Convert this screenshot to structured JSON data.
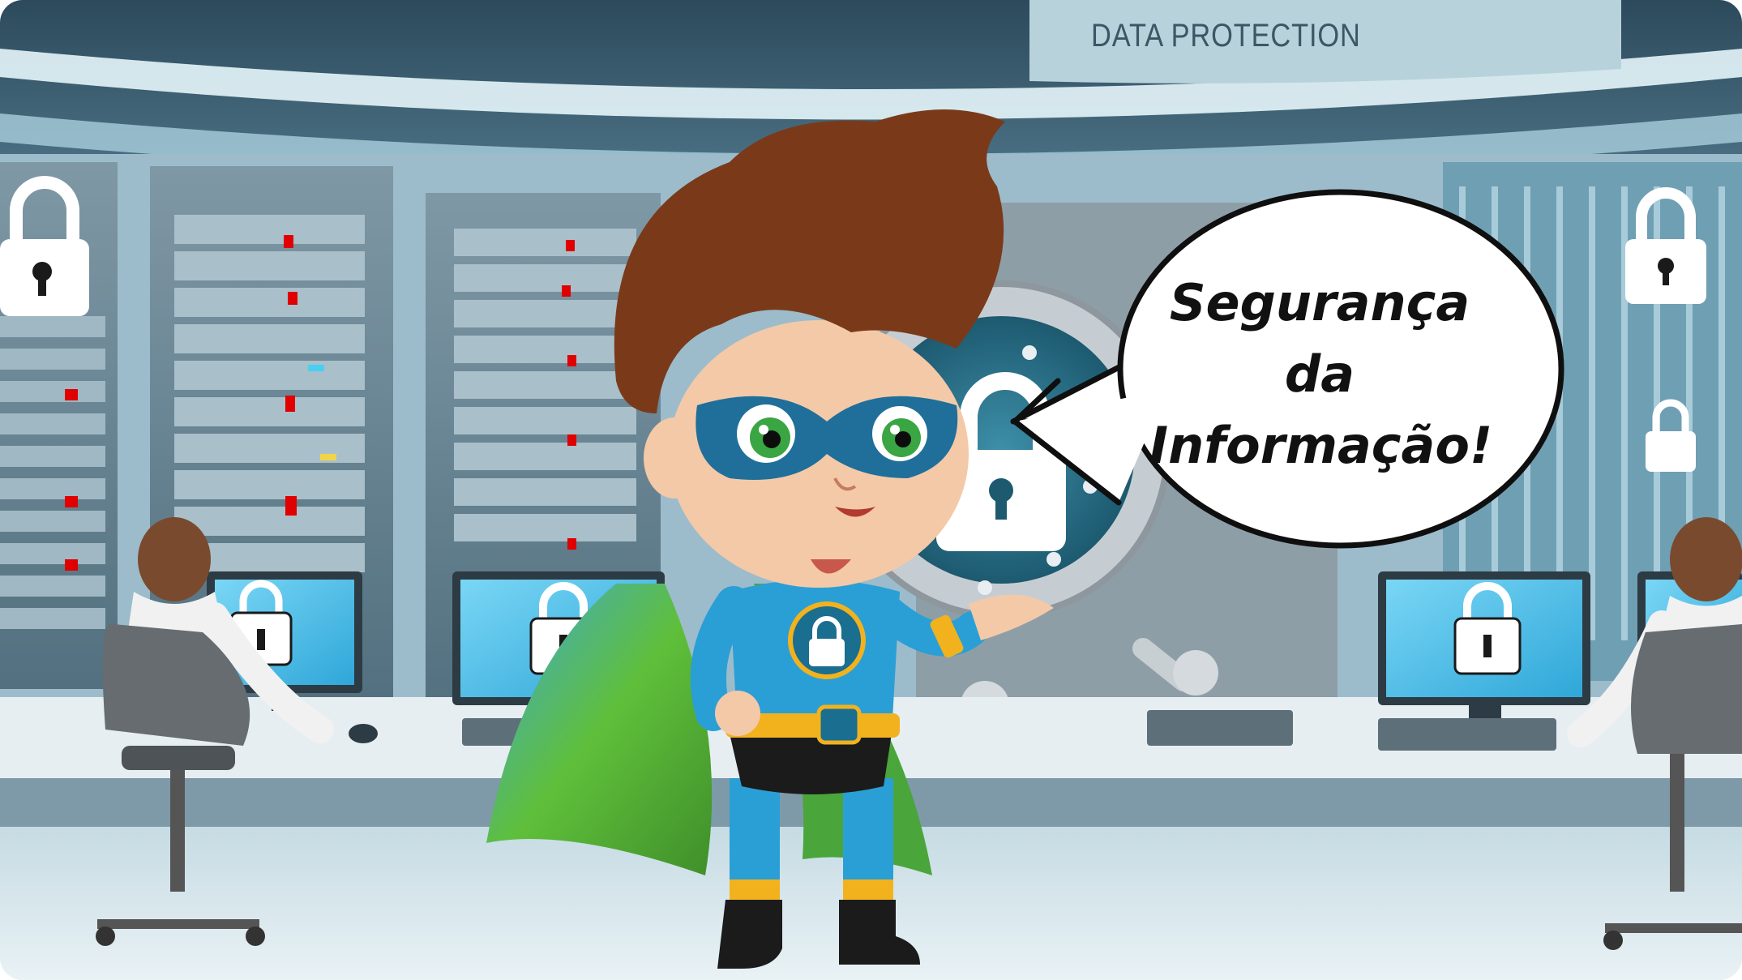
{
  "scene": {
    "sign_text": "DATA PROTECTION",
    "speech_bubble": {
      "lines": [
        "Segurança",
        "da",
        "Informação!"
      ]
    },
    "colors": {
      "room_light": "#cfe6ef",
      "room_dark": "#2f5f73",
      "cape_green": "#5fbf3a",
      "suit_blue": "#2a9fd6",
      "mask_blue": "#1f6f9a",
      "hair_brown": "#7a3a1a",
      "screen_cyan": "#59c9ef",
      "lock_white": "#ffffff"
    }
  }
}
